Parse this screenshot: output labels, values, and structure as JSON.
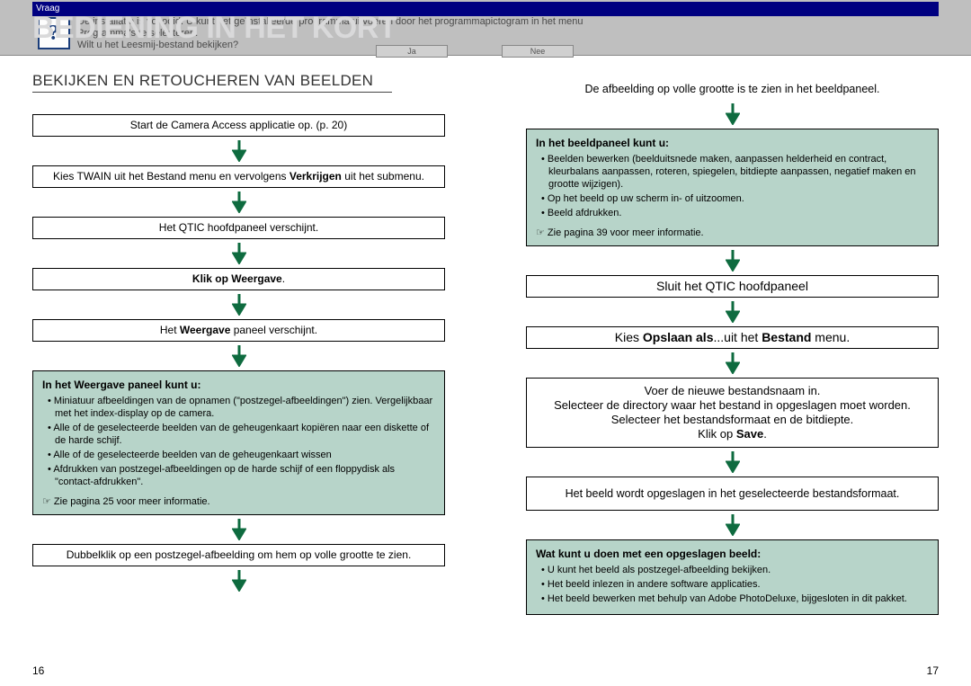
{
  "header": {
    "window_title": "Vraag",
    "icon_glyph": "?",
    "text_line1": "De installatie is voltooid. U kunt het geïnstalleerde programma uitvoeren door het programmapictogram in het menu",
    "text_line2": "Programma's te selecteren.",
    "text_line3": "Wilt u het Leesmij-bestand bekijken?",
    "btn_yes": "Ja",
    "btn_no": "Nee"
  },
  "main_title": "BEDIENING IN HET KORT",
  "section_title": "BEKIJKEN EN RETOUCHEREN VAN BEELDEN",
  "left": {
    "box1": "Start de Camera Access applicatie op. (p. 20)",
    "box2_pre": "Kies TWAIN uit het Bestand menu en vervolgens ",
    "box2_bold": "Verkrijgen",
    "box2_post": " uit het submenu.",
    "box3": "Het QTIC hoofdpaneel verschijnt.",
    "box4_pre": "Klik op ",
    "box4_bold": "Weergave",
    "box4_post": ".",
    "box5_pre": "Het ",
    "box5_bold": "Weergave",
    "box5_post": " paneel verschijnt.",
    "green1": {
      "title": "In het Weergave paneel kunt u:",
      "items": [
        "Miniatuur afbeeldingen van de opnamen (\"postzegel-afbeeldingen\") zien. Vergelijkbaar met het index-display op de camera.",
        "Alle of de geselecteerde beelden van de geheugenkaart kopiëren naar een diskette of de harde schijf.",
        "Alle of de geselecteerde beelden van de geheugenkaart wissen",
        "Afdrukken van postzegel-afbeeldingen op de harde schijf of een floppydisk als \"contact-afdrukken\"."
      ],
      "footnote": "☞ Zie pagina 25 voor meer informatie."
    },
    "box6": "Dubbelklik op een postzegel-afbeelding om hem op volle grootte te zien."
  },
  "right": {
    "intro": "De afbeelding op volle grootte is te zien in het beeldpaneel.",
    "green1": {
      "title": "In het beeldpaneel kunt u:",
      "items": [
        "Beelden bewerken (beelduitsnede maken, aanpassen helderheid en contract, kleurbalans aanpassen, roteren, spiegelen, bitdiepte aanpassen, negatief maken en grootte wijzigen).",
        "Op het beeld op uw scherm in- of uitzoomen.",
        "Beeld afdrukken."
      ],
      "footnote": "☞ Zie pagina 39 voor meer informatie."
    },
    "box1": "Sluit het QTIC hoofdpaneel",
    "box2_pre": "Kies ",
    "box2_bold1": "Opslaan als",
    "box2_mid": "...uit het ",
    "box2_bold2": "Bestand",
    "box2_post": " menu.",
    "box3_l1": "Voer de nieuwe bestandsnaam in.",
    "box3_l2": "Selecteer de directory waar het bestand in opgeslagen moet worden.",
    "box3_l3": "Selecteer het bestandsformaat en de bitdiepte.",
    "box3_l4_pre": "Klik op ",
    "box3_l4_bold": "Save",
    "box3_l4_post": ".",
    "box4": "Het beeld wordt opgeslagen in het geselecteerde bestandsformaat.",
    "green2": {
      "title": "Wat kunt u doen met een opgeslagen beeld:",
      "items": [
        "U kunt het beeld als postzegel-afbeelding bekijken.",
        "Het beeld inlezen in andere software applicaties.",
        "Het beeld bewerken met behulp van Adobe PhotoDeluxe, bijgesloten in dit pakket."
      ]
    }
  },
  "page_left": "16",
  "page_right": "17",
  "colors": {
    "arrow": "#0e6b3f"
  }
}
